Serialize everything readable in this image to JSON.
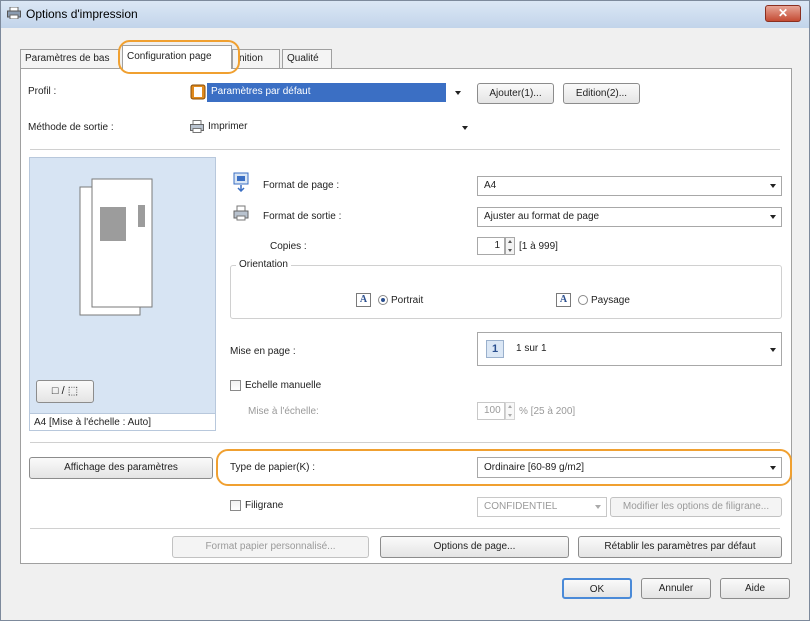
{
  "window": {
    "title": "Options d'impression",
    "close_glyph": "✕"
  },
  "tabs": [
    {
      "label": "Paramètres de bas"
    },
    {
      "label": "Configuration page"
    },
    {
      "label": "nition"
    },
    {
      "label": "Qualité"
    }
  ],
  "profile": {
    "label": "Profil :",
    "value": "Paramètres par défaut",
    "add_button": "Ajouter(1)...",
    "edit_button": "Edition(2)..."
  },
  "output_method": {
    "label": "Méthode de sortie :",
    "value": "Imprimer"
  },
  "preview": {
    "caption": "A4 [Mise à l'échelle : Auto]",
    "toggle_glyph": "□ / ⬚"
  },
  "page_size": {
    "label": "Format de page :",
    "value": "A4"
  },
  "output_size": {
    "label": "Format de sortie :",
    "value": "Ajuster au format de page"
  },
  "copies": {
    "label": "Copies :",
    "value": "1",
    "range": "[1 à 999]"
  },
  "orientation": {
    "legend": "Orientation",
    "portrait": "Portrait",
    "landscape": "Paysage",
    "selected": "portrait",
    "icon_letter": "A"
  },
  "layout": {
    "label": "Mise en page :",
    "value": "1 sur 1",
    "icon_number": "1"
  },
  "manual_scaling": {
    "label": "Echelle manuelle",
    "scale_label": "Mise à l'échelle:",
    "value": "100",
    "range": "% [25 à 200]",
    "checked": false
  },
  "settings_button": "Affichage des paramètres",
  "paper_type": {
    "label": "Type de papier(K) :",
    "value": "Ordinaire [60-89 g/m2]"
  },
  "watermark": {
    "label": "Filigrane",
    "value": "CONFIDENTIEL",
    "edit_button": "Modifier les options de filigrane...",
    "checked": false
  },
  "custom_paper_button": "Format papier personnalisé...",
  "page_options_button": "Options de page...",
  "restore_defaults_button": "Rétablir les paramètres par défaut",
  "footer": {
    "ok": "OK",
    "cancel": "Annuler",
    "help": "Aide"
  },
  "colors": {
    "highlight": "#f0a030",
    "selection": "#3b6fc4",
    "close": "#c44b33"
  }
}
